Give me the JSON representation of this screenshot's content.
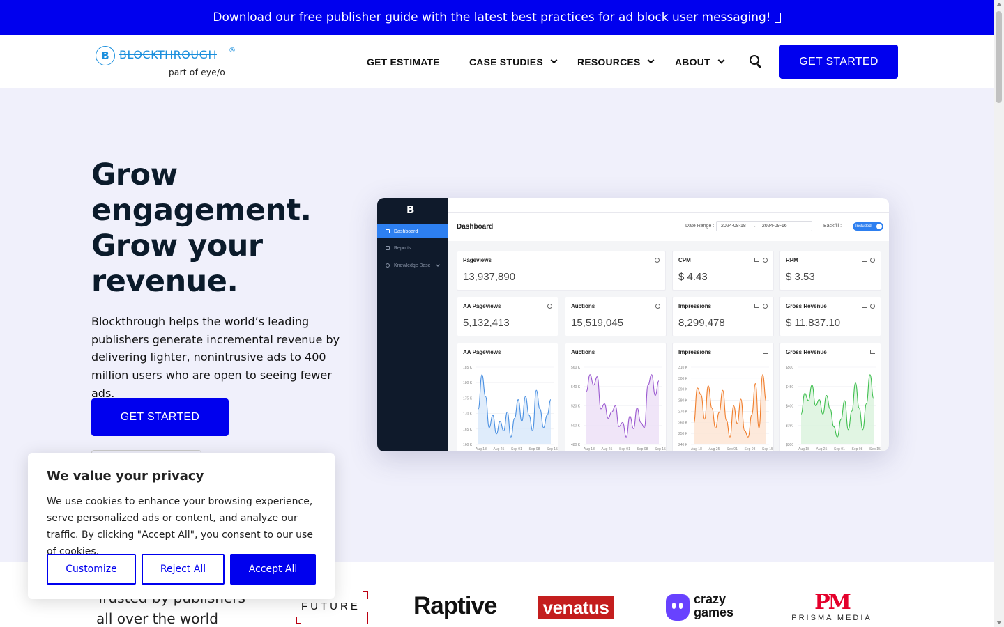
{
  "announcement": {
    "text": "Download our free publisher guide with the latest best practices for ad block user messaging!"
  },
  "header": {
    "logo_text": "BLOCKTHROUGH",
    "logo_reg": "®",
    "logo_mark": "B",
    "logo_sub": "part of eye/o",
    "nav": [
      {
        "label": "GET ESTIMATE"
      },
      {
        "label": "CASE STUDIES"
      },
      {
        "label": "RESOURCES"
      },
      {
        "label": "ABOUT"
      }
    ],
    "cta": "GET STARTED"
  },
  "hero": {
    "title": "Grow engagement. Grow your revenue.",
    "description": "Blockthrough helps the world’s leading publishers generate incremental revenue by delivering lighter, nonintrusive ads to 400 million users who are open to seeing fewer ads.",
    "cta": "GET STARTED"
  },
  "dashboard": {
    "logo": "B",
    "sidebar": [
      {
        "label": "Dashboard"
      },
      {
        "label": "Reports"
      },
      {
        "label": "Knowledge Base"
      }
    ],
    "title": "Dashboard",
    "date_range_label": "Date Range :",
    "date_from": "2024-08-18",
    "date_arrow": "→",
    "date_to": "2024-09-16",
    "backfill_label": "Backfill :",
    "backfill_value": "Included",
    "metrics": [
      {
        "label": "Pageviews",
        "value": "13,937,890"
      },
      {
        "label": "CPM",
        "value": "$ 4.43"
      },
      {
        "label": "RPM",
        "value": "$ 3.53"
      },
      {
        "label": "AA Pageviews",
        "value": "5,132,413"
      },
      {
        "label": "Auctions",
        "value": "15,519,045"
      },
      {
        "label": "Impressions",
        "value": "8,299,478"
      },
      {
        "label": "Gross Revenue",
        "value": "$ 11,837.10"
      }
    ],
    "charts": [
      {
        "title": "AA Pageviews",
        "color": "#4a90e2",
        "fill": "#d7e7fa",
        "yticks": [
          "185 K",
          "180 K",
          "175 K",
          "170 K",
          "165 K",
          "160 K"
        ],
        "xticks": [
          "Aug 18",
          "Aug 25",
          "Sep 01",
          "Sep 08",
          "Sep 15"
        ],
        "values": [
          172,
          183,
          176,
          166,
          170,
          164,
          168,
          165,
          171,
          163,
          169,
          175,
          168,
          176,
          170,
          165,
          178,
          172,
          166,
          170,
          175
        ]
      },
      {
        "title": "Auctions",
        "color": "#9b59d0",
        "fill": "#ecdff6",
        "yticks": [
          "560 K",
          "540 K",
          "520 K",
          "500 K",
          "480 K"
        ],
        "xticks": [
          "Aug 18",
          "Aug 25",
          "Sep 01",
          "Sep 08",
          "Sep 15"
        ],
        "values": [
          532,
          548,
          538,
          546,
          515,
          520,
          506,
          512,
          518,
          498,
          502,
          488,
          508,
          496,
          516,
          502,
          497,
          538,
          548,
          528,
          542
        ]
      },
      {
        "title": "Impressions",
        "color": "#f07d2b",
        "fill": "#fde4d2",
        "yticks": [
          "310 K",
          "300 K",
          "290 K",
          "280 K",
          "270 K",
          "260 K",
          "250 K",
          "240 K"
        ],
        "xticks": [
          "Aug 18",
          "Aug 25",
          "Sep 01",
          "Sep 08",
          "Sep 15"
        ],
        "values": [
          262,
          294,
          288,
          266,
          296,
          276,
          258,
          272,
          292,
          265,
          250,
          278,
          262,
          284,
          256,
          250,
          270,
          298,
          258,
          306,
          282
        ]
      },
      {
        "title": "Gross Revenue",
        "color": "#3fbf4f",
        "fill": "#d9f3dc",
        "yticks": [
          "$500",
          "$450",
          "$400",
          "$350",
          "$300"
        ],
        "xticks": [
          "Aug 18",
          "Aug 25",
          "Sep 01",
          "Sep 08",
          "Sep 15"
        ],
        "values": [
          392,
          432,
          418,
          448,
          408,
          420,
          392,
          428,
          402,
          368,
          348,
          382,
          418,
          362,
          398,
          452,
          404,
          362,
          412,
          468,
          422
        ]
      }
    ]
  },
  "cookie": {
    "title": "We value your privacy",
    "text": "We use cookies to enhance your browsing experience, serve personalized ads or content, and analyze our traffic. By clicking \"Accept All\", you consent to our use of cookies.",
    "customize": "Customize",
    "reject": "Reject All",
    "accept": "Accept All"
  },
  "logos": {
    "trusted": "Trusted by publishers all over the world",
    "future": "FUTURE",
    "raptive": "Raptive",
    "venatus": "venatus",
    "crazygames_line1": "crazy",
    "crazygames_line2": "games",
    "prisma_mark": "PM",
    "prisma_text": "PRISMA MEDIA"
  }
}
